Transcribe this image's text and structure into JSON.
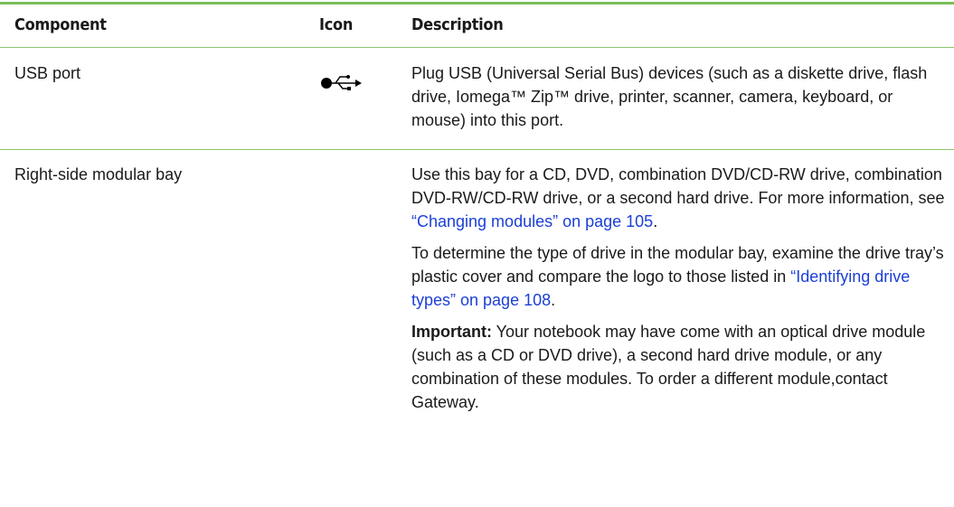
{
  "header": {
    "component": "Component",
    "icon": "Icon",
    "description": "Description"
  },
  "rows": [
    {
      "component": "USB port",
      "icon": "usb-icon",
      "description": "Plug USB (Universal Serial Bus) devices (such as a diskette drive, flash drive, Iomega™ Zip™ drive, printer, scanner, camera, keyboard, or mouse) into this port."
    },
    {
      "component": "Right-side modular bay",
      "icon": "",
      "para1_text": "Use this bay for a CD, DVD, combination DVD/CD-RW drive, combination DVD-RW/CD-RW drive, or a second hard drive. For more information, see ",
      "para1_link": "“Changing modules” on page 105",
      "para1_end": ".",
      "para2_text": "To determine the type of drive in the modular bay, examine the drive tray’s plastic cover and compare the logo to those listed in ",
      "para2_link": "“Identifying drive types” on page 108",
      "para2_end": ".",
      "para3_bold": "Important:",
      "para3_text": " Your notebook may have come with an optical drive module (such as a CD or DVD drive), a second hard drive module, or any combination of these modules. To order a different module,contact Gateway."
    }
  ],
  "colors": {
    "rule": "#7bbd5b",
    "link": "#1b3fd6"
  }
}
